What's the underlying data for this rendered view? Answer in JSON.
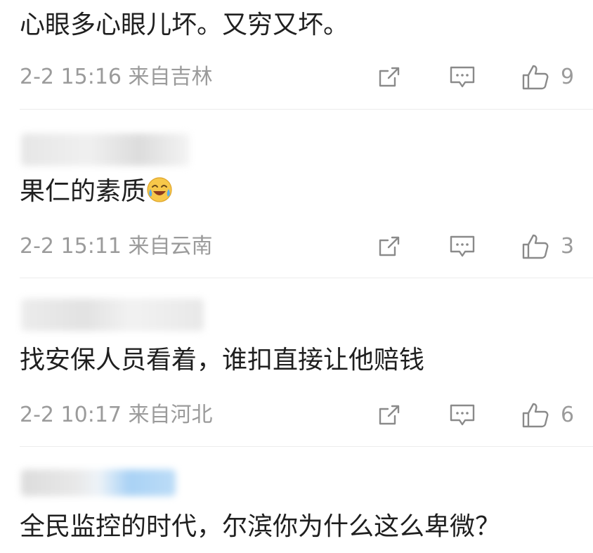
{
  "comments": [
    {
      "text": "心眼多心眼儿坏。又穷又坏。",
      "time": "2-2 15:16",
      "location": "来自吉林",
      "likes": "9"
    },
    {
      "text": "果仁的素质",
      "emoji": "laughing-crying-face-emoji",
      "time": "2-2 15:11",
      "location": "来自云南",
      "likes": "3"
    },
    {
      "text": "找安保人员看着，谁扣直接让他赔钱",
      "time": "2-2 10:17",
      "location": "来自河北",
      "likes": "6"
    },
    {
      "text": "全民监控的时代，尔滨你为什么这么卑微？"
    }
  ],
  "icons": {
    "share": "share-icon",
    "comment": "comment-icon",
    "like": "thumbs-up-icon"
  },
  "colors": {
    "meta_gray": "#9b9b9b",
    "icon_gray": "#8a8a8a",
    "divider": "#ececec",
    "blur_blue": "#a9d2f5"
  }
}
